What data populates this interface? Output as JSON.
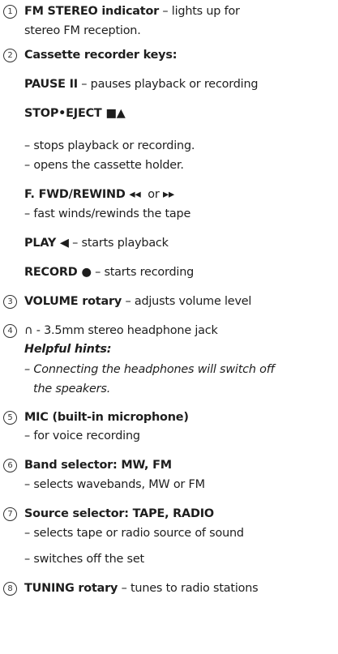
{
  "items": [
    {
      "num": "1",
      "name": "FM STEREO indicator",
      "desc": " – lights up for",
      "desc2": "stereo FM reception."
    },
    {
      "num": "2",
      "name": "Cassette recorder keys:"
    },
    {
      "pause_name": "PAUSE II",
      "pause_desc": " – pauses playback or recording"
    },
    {
      "stop_name": "STOP•EJECT ■▲",
      "stop_desc1": "– stops playback or recording.",
      "stop_desc2": "– opens the cassette holder."
    },
    {
      "ffwd_name": "F. FWD/REWIND ◂◂",
      "ffwd_or": "  or ",
      "ffwd_sym": "▸▸",
      "ffwd_desc": "– fast winds/rewinds the tape"
    },
    {
      "play_name": "PLAY ◀",
      "play_desc": " – starts playback"
    },
    {
      "rec_name": "RECORD ●",
      "rec_desc": " – starts recording"
    },
    {
      "num": "3",
      "name": "VOLUME rotary",
      "desc": " – adjusts volume level"
    },
    {
      "num": "4",
      "glyph": "∩",
      "desc": " - 3.5mm stereo headphone jack",
      "hint_title": "Helpful hints:",
      "hint1": "– Connecting the headphones will switch off",
      "hint2": "the speakers."
    },
    {
      "num": "5",
      "name": "MIC (built-in microphone)",
      "desc": "– for voice recording"
    },
    {
      "num": "6",
      "name": "Band selector: MW, FM",
      "desc": "– selects wavebands, MW or FM"
    },
    {
      "num": "7",
      "name": "Source selector: TAPE, RADIO",
      "desc": "– selects tape or radio source of sound",
      "desc2": "– switches off the set"
    },
    {
      "num": "8",
      "name": "TUNING rotary",
      "desc": " – tunes to radio stations"
    }
  ]
}
